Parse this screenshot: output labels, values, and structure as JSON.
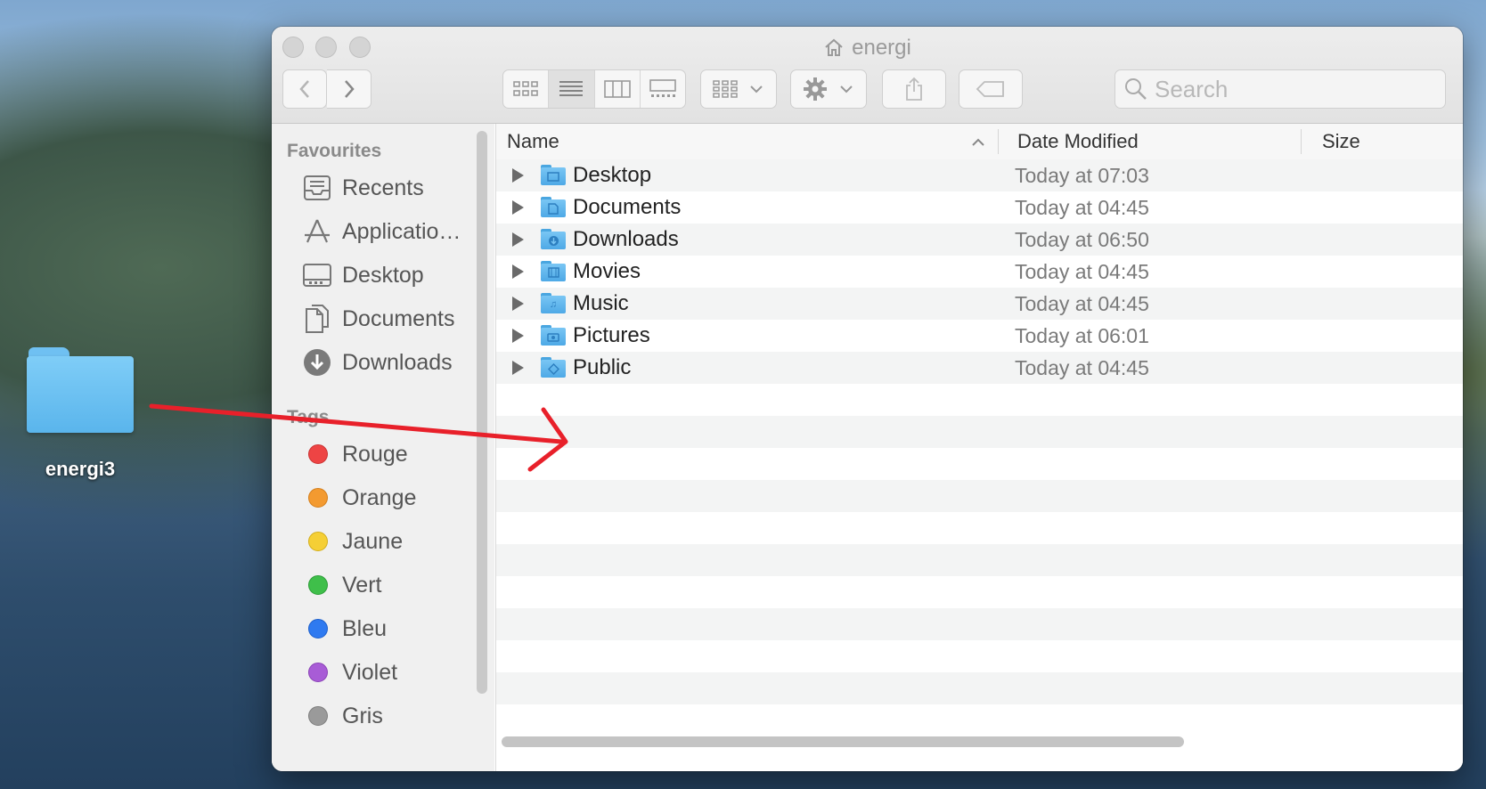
{
  "desktop": {
    "folder_label": "energi3"
  },
  "window": {
    "title": "energi"
  },
  "toolbar": {
    "search_placeholder": "Search"
  },
  "sidebar": {
    "favourites_header": "Favourites",
    "favourites": [
      {
        "label": "Recents",
        "icon": "recents-icon"
      },
      {
        "label": "Applicatio…",
        "icon": "applications-icon"
      },
      {
        "label": "Desktop",
        "icon": "desktop-icon"
      },
      {
        "label": "Documents",
        "icon": "documents-icon"
      },
      {
        "label": "Downloads",
        "icon": "downloads-icon"
      }
    ],
    "tags_header": "Tags",
    "tags": [
      {
        "label": "Rouge",
        "color": "#ee4444"
      },
      {
        "label": "Orange",
        "color": "#f39a30"
      },
      {
        "label": "Jaune",
        "color": "#f5cf35"
      },
      {
        "label": "Vert",
        "color": "#3fbf4a"
      },
      {
        "label": "Bleu",
        "color": "#2f7af0"
      },
      {
        "label": "Violet",
        "color": "#a85cd6"
      },
      {
        "label": "Gris",
        "color": "#9a9a9a"
      }
    ]
  },
  "columns": {
    "name": "Name",
    "date": "Date Modified",
    "size": "Size"
  },
  "files": [
    {
      "name": "Desktop",
      "date": "Today at 07:03"
    },
    {
      "name": "Documents",
      "date": "Today at 04:45"
    },
    {
      "name": "Downloads",
      "date": "Today at 06:50"
    },
    {
      "name": "Movies",
      "date": "Today at 04:45"
    },
    {
      "name": "Music",
      "date": "Today at 04:45"
    },
    {
      "name": "Pictures",
      "date": "Today at 06:01"
    },
    {
      "name": "Public",
      "date": "Today at 04:45"
    }
  ],
  "annotation": {
    "color": "#e8202a"
  }
}
